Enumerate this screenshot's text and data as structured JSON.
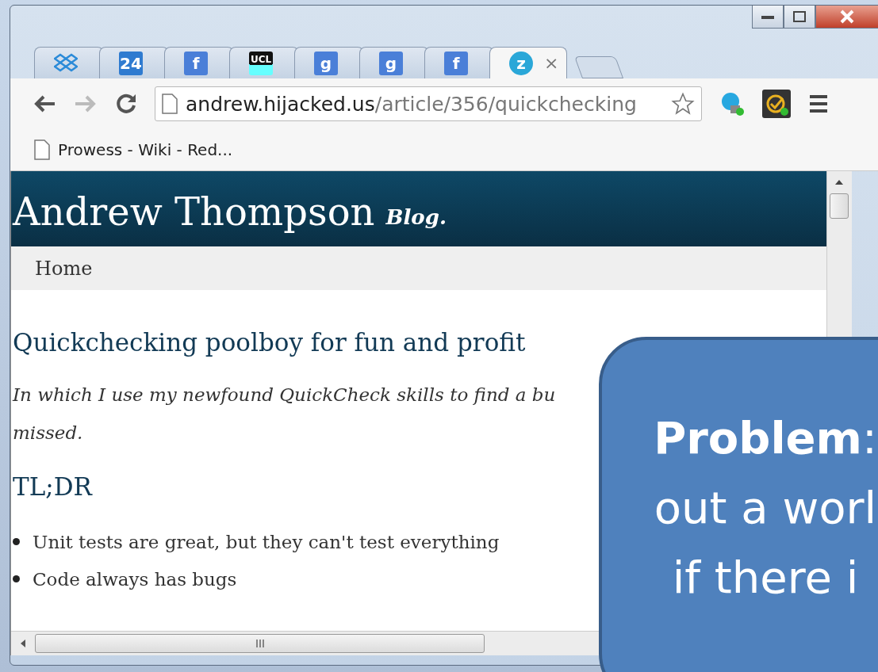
{
  "tabs": [
    {
      "kind": "box",
      "selected": false
    },
    {
      "kind": "calendar",
      "glyph": "24",
      "selected": false
    },
    {
      "kind": "square",
      "glyph": "f",
      "selected": false
    },
    {
      "kind": "ucl",
      "glyph": "UCL",
      "selected": false
    },
    {
      "kind": "square",
      "glyph": "g",
      "selected": false
    },
    {
      "kind": "square",
      "glyph": "g",
      "selected": false
    },
    {
      "kind": "square",
      "glyph": "f",
      "selected": false
    },
    {
      "kind": "circle",
      "glyph": "z",
      "selected": true,
      "close": "×"
    }
  ],
  "address": {
    "host": "andrew.hijacked.us",
    "path": "/article/356/quickchecking"
  },
  "bookmarks": [
    "Prowess - Wiki - Red..."
  ],
  "site": {
    "title": "Andrew Thompson",
    "tag": "Blog.",
    "nav": [
      "Home"
    ]
  },
  "article": {
    "title": "Quickchecking poolboy for fun and profit",
    "lead": "In which I use my newfound QuickCheck skills to find a bu",
    "lead_2": "missed.",
    "heading": "TL;DR",
    "bullets": [
      "Unit tests are great, but they can't test everything",
      "Code always has bugs"
    ]
  },
  "callout": {
    "lines": [
      "**Problem**:",
      "out a worl",
      "if there i"
    ]
  }
}
